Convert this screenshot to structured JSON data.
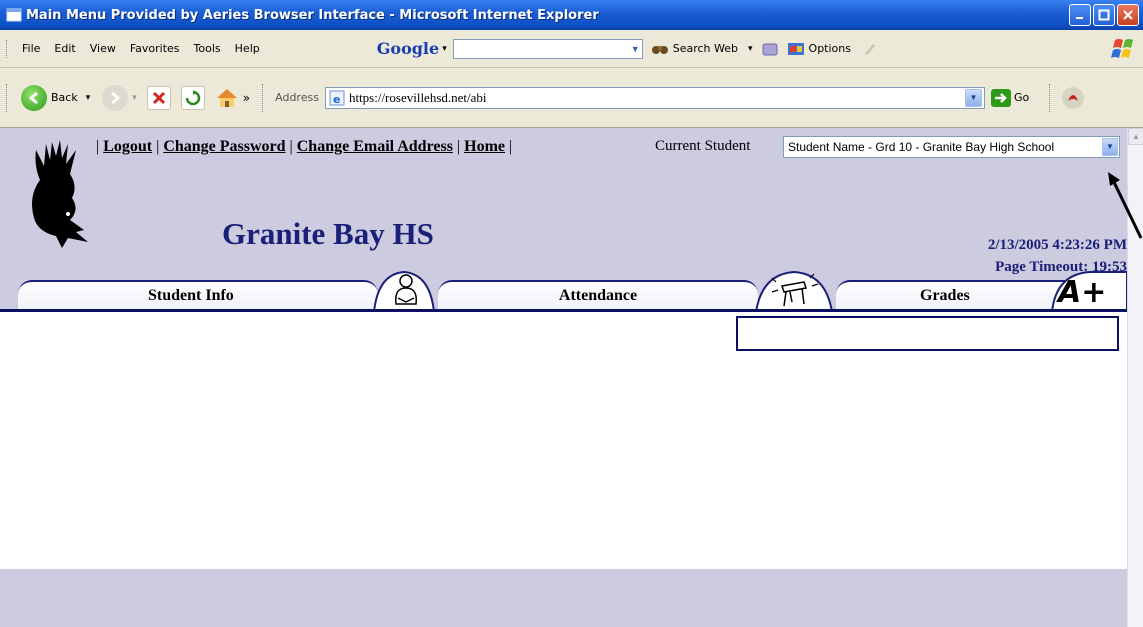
{
  "window": {
    "title": "Main Menu Provided by Aeries Browser Interface - Microsoft Internet Explorer",
    "colors": {
      "titlebar": "#1b5fd6",
      "chrome": "#ece9d8",
      "page_bg": "#cccbe0",
      "accent": "#1a2077"
    }
  },
  "menubar": {
    "items": [
      "File",
      "Edit",
      "View",
      "Favorites",
      "Tools",
      "Help"
    ],
    "google_label": "Google",
    "search_web_label": "Search Web",
    "options_label": "Options"
  },
  "toolbar": {
    "back_label": "Back",
    "address_label": "Address",
    "address_value": "https://rosevillehsd.net/abi",
    "go_label": "Go"
  },
  "page": {
    "links": [
      "Logout",
      "Change Password",
      "Change Email Address",
      "Home"
    ],
    "current_student_label": "Current Student",
    "student_selected": "Student Name - Grd 10 - Granite Bay High School",
    "school_name": "Granite Bay HS",
    "datetime": "2/13/2005 4:23:26 PM",
    "timeout_label": "Page Timeout:",
    "timeout_value": "19:53",
    "tabs": [
      {
        "label": "Student Info",
        "icon": "student-reading-icon"
      },
      {
        "label": "Attendance",
        "icon": "school-desk-icon"
      },
      {
        "label": "Grades",
        "icon": "a-plus-icon"
      }
    ],
    "grades_icon_text": "A+"
  }
}
